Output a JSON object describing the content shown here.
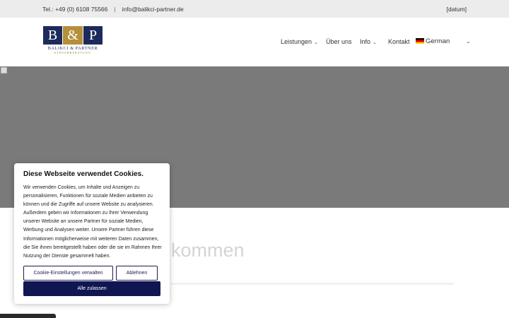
{
  "topbar": {
    "phone": "Tel.: +49 (0) 6108 75566",
    "separator": "|",
    "email": "info@balikci-partner.de",
    "date_placeholder": "[datum]"
  },
  "logo": {
    "letter_left": "B",
    "ampersand": "&",
    "letter_right": "P",
    "name": "BALIKCI & PARTNER",
    "subtitle": "STEUERBERATUNG",
    "colors": {
      "navy": "#1c2b5c",
      "gold": "#b58f3a"
    }
  },
  "nav": {
    "items": [
      {
        "label": "Leistungen",
        "has_dropdown": true
      },
      {
        "label": "Über uns",
        "has_dropdown": false
      },
      {
        "label": "Info",
        "has_dropdown": true
      },
      {
        "label": "Kontakt",
        "has_dropdown": false
      }
    ],
    "language": {
      "label": "German",
      "flag": "flag-de-icon"
    }
  },
  "hero": {
    "background": "#7a7a7a"
  },
  "background_text": {
    "heading_fragment": "kommen"
  },
  "cookie_banner": {
    "title": "Diese Webseite verwendet Cookies.",
    "message": "Wir verwenden Cookies, um Inhalte und Anzeigen zu personalisieren, Funktionen für soziale Medien anbieten zu können und die Zugriffe auf unsere Website zu analysieren. Außerdem geben wir Informationen zu Ihrer Verwendung unserer Website an unsere Partner für soziale Medien, Werbung und Analysen weiter. Unsere Partner führen diese Informationen möglicherweise mit weiteren Daten zusammen, die Sie ihnen bereitgestellt haben oder die sie im Rahmen Ihrer Nutzung der Dienste gesammelt haben.",
    "manage_label": "Cookie-Einstellungen verwalten",
    "deny_label": "Ablehnen",
    "accept_label": "Alle zulassen",
    "accent_color": "#0f1652"
  }
}
